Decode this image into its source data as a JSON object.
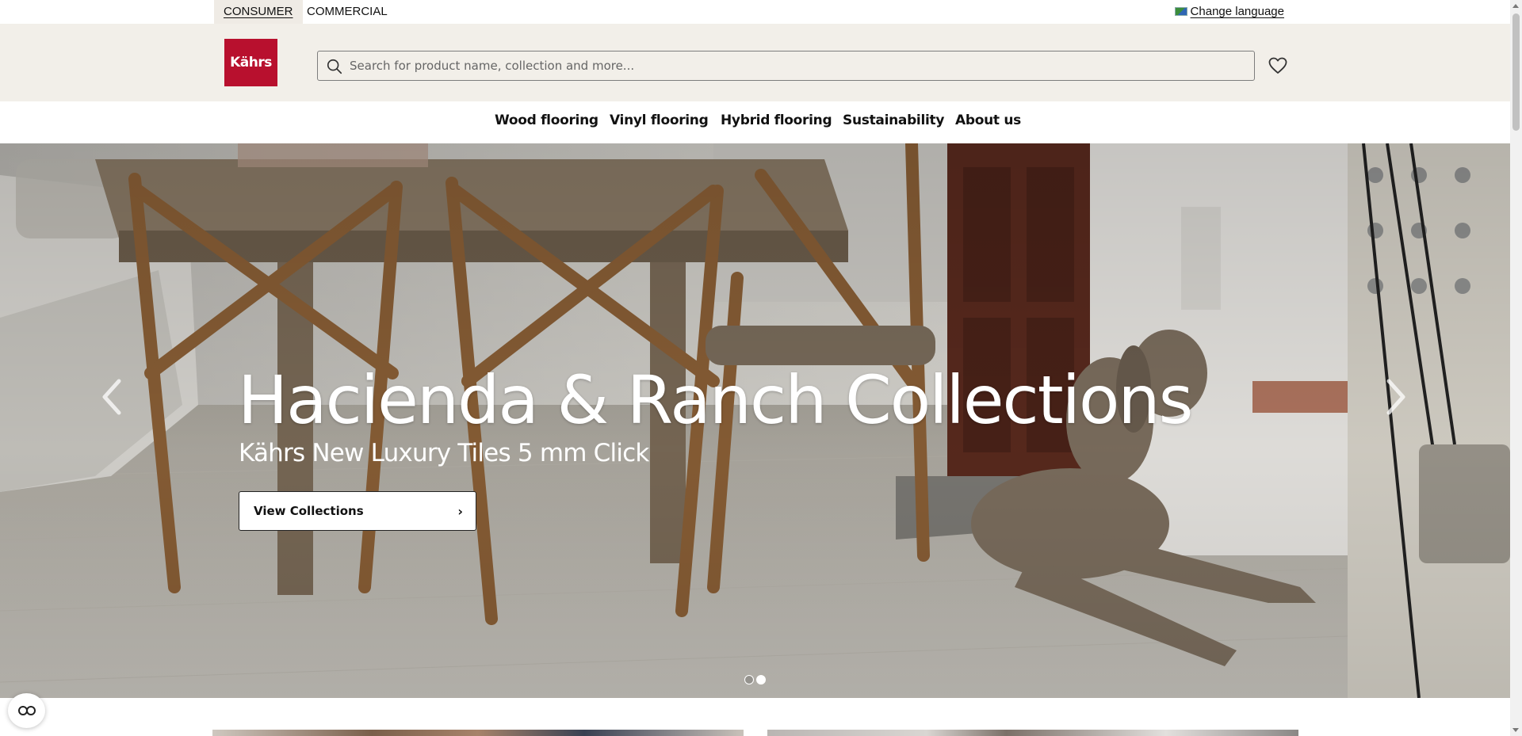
{
  "topbar": {
    "segments": [
      "CONSUMER",
      "COMMERCIAL"
    ],
    "active_segment": "CONSUMER",
    "language_label": "Change language"
  },
  "header": {
    "logo_text": "Kährs",
    "search_placeholder": "Search for product name, collection and more..."
  },
  "nav": {
    "items": [
      "Wood flooring",
      "Vinyl flooring",
      "Hybrid flooring",
      "Sustainability",
      "About us"
    ]
  },
  "hero": {
    "title": "Hacienda & Ranch Collections",
    "subtitle": "Kährs New Luxury Tiles 5 mm Click",
    "cta_label": "View Collections",
    "slide_count": 2,
    "active_slide": 2
  },
  "colors": {
    "brand_red": "#b8102e",
    "header_bg": "#f2efe9"
  }
}
